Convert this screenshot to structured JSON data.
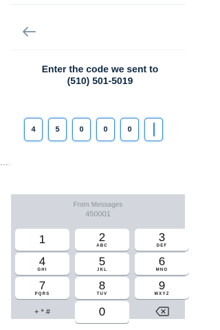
{
  "title": {
    "line1": "Enter the code we sent to",
    "line2": "(510) 501-5019"
  },
  "code_digits": [
    "4",
    "5",
    "0",
    "0",
    "0",
    ""
  ],
  "suggestion": {
    "source": "From Messages",
    "code": "450001"
  },
  "keypad": [
    {
      "num": "1",
      "letters": ""
    },
    {
      "num": "2",
      "letters": "ABC"
    },
    {
      "num": "3",
      "letters": "DEF"
    },
    {
      "num": "4",
      "letters": "GHI"
    },
    {
      "num": "5",
      "letters": "JKL"
    },
    {
      "num": "6",
      "letters": "MNO"
    },
    {
      "num": "7",
      "letters": "PQRS"
    },
    {
      "num": "8",
      "letters": "TUV"
    },
    {
      "num": "9",
      "letters": "WXYZ"
    }
  ],
  "bottom_row": {
    "symbols": "+ * #",
    "zero": "0"
  },
  "colors": {
    "accent": "#2f86d7",
    "title": "#0d2740",
    "keyboard_bg": "#d3d7dd"
  },
  "icons": {
    "back": "arrow-left-icon",
    "delete": "backspace-icon"
  }
}
